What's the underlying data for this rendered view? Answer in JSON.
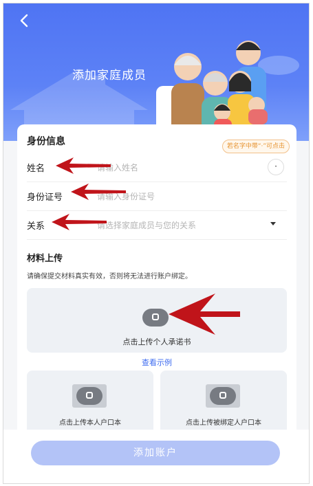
{
  "header": {
    "title": "添加家庭成员"
  },
  "identity": {
    "section_title": "身份信息",
    "tip_tag": "若名字中带“·”可点击",
    "dot_button": "·",
    "name": {
      "label": "姓名",
      "placeholder": "请输入姓名"
    },
    "id_number": {
      "label": "身份证号",
      "placeholder": "请输入身份证号"
    },
    "relation": {
      "label": "关系",
      "placeholder": "请选择家庭成员与您的关系"
    }
  },
  "materials": {
    "section_title": "材料上传",
    "hint": "请确保提交材料真实有效，否则将无法进行账户绑定。",
    "main_upload_label": "点击上传个人承诺书",
    "example_link": "查看示例",
    "left_upload_label": "点击上传本人户口本",
    "right_upload_label": "点击上传被绑定人户口本"
  },
  "footer": {
    "add_button": "添加账户"
  },
  "colors": {
    "brand": "#4f74f3",
    "button_disabled": "#b3c3f7",
    "annotation_arrow": "#c0141a",
    "tip": "#e6922e"
  }
}
